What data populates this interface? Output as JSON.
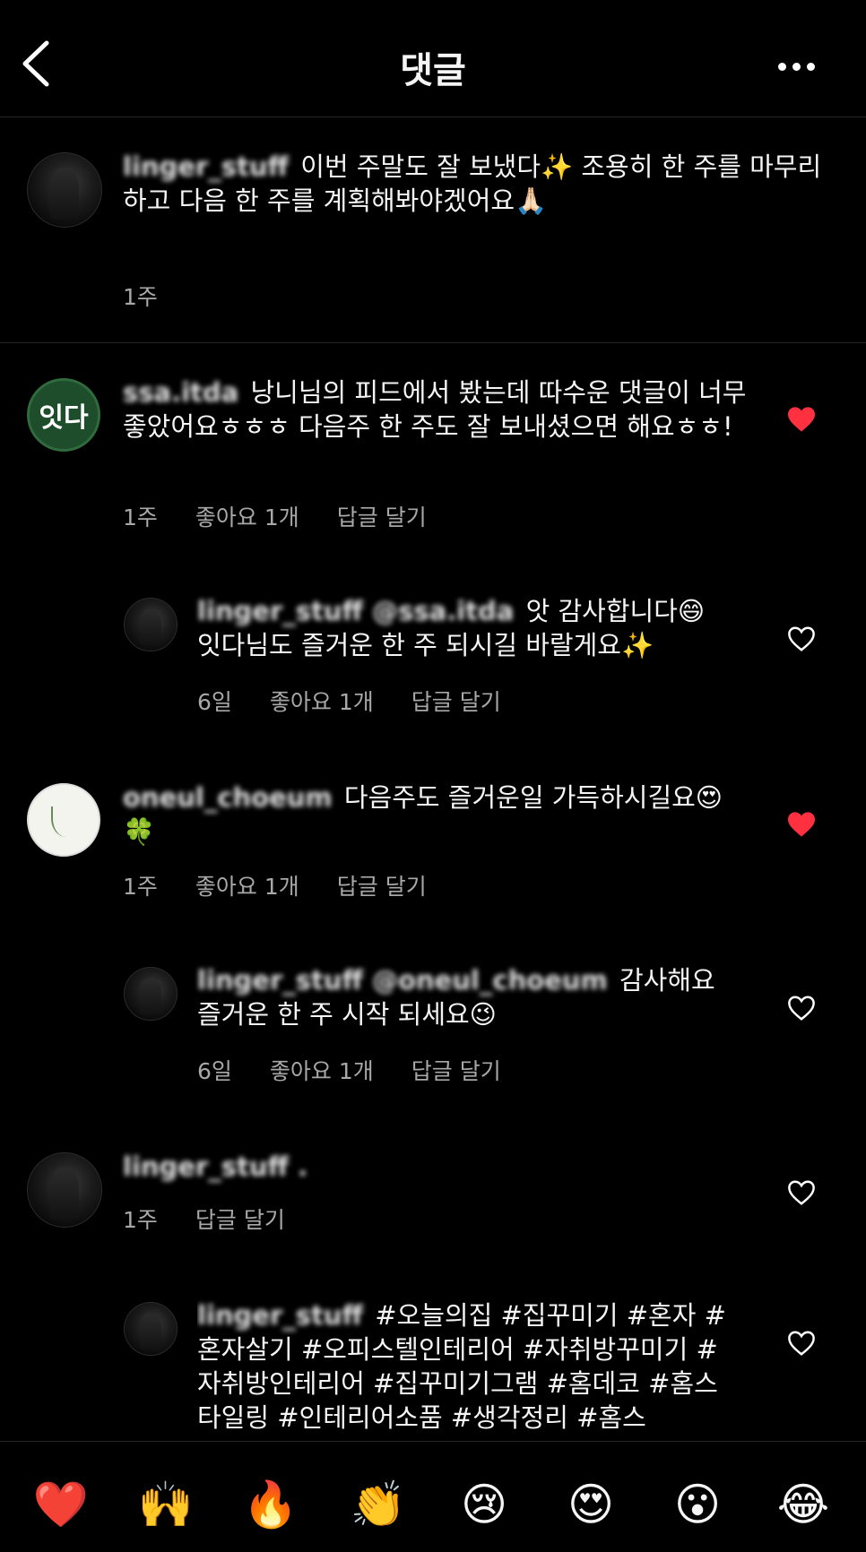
{
  "header": {
    "title": "댓글"
  },
  "caption": {
    "username": "linger_stuff",
    "text": "이번 주말도 잘 보냈다✨ 조용히 한 주를 마무리하고 다음 한 주를 계획해봐야겠어요🙏🏻",
    "time": "1주"
  },
  "comments": [
    {
      "username": "ssa.itda",
      "text": "낭니님의 피드에서 봤는데 따수운 댓글이 너무 좋았어요ㅎㅎㅎ 다음주 한 주도 잘 보내셨으면 해요ㅎㅎ!",
      "time": "1주",
      "likes": "좋아요 1개",
      "reply": "답글 달기"
    },
    {
      "username": "linger_stuff @ssa.itda",
      "text": "앗 감사합니다😄 잇다님도 즐거운 한 주 되시길 바랄게요✨",
      "time": "6일",
      "likes": "좋아요 1개",
      "reply": "답글 달기"
    },
    {
      "username": "oneul_choeum",
      "text": "다음주도 즐거운일 가득하시길요😍🍀",
      "time": "1주",
      "likes": "좋아요 1개",
      "reply": "답글 달기"
    },
    {
      "username": "linger_stuff @oneul_choeum",
      "text": "감사해요 즐거운 한 주 시작 되세요😉",
      "time": "6일",
      "likes": "좋아요 1개",
      "reply": "답글 달기"
    },
    {
      "username": "linger_stuff .",
      "text": "",
      "time": "1주",
      "reply": "답글 달기"
    },
    {
      "username": "linger_stuff",
      "text": "#오늘의집 #집꾸미기 #혼자 #혼자살기 #오피스텔인테리어 #자취방꾸미기 #자취방인테리어 #집꾸미기그램 #홈데코 #홈스타일링 #인테리어소품 #생각정리 #홈스"
    }
  ],
  "itda_avatar_text": "잇다",
  "reactions": [
    "❤️",
    "🙌",
    "🔥",
    "👏",
    "😢",
    "😍",
    "😮",
    "😂"
  ],
  "colors": {
    "liked": "#ff3040",
    "muted": "#a8a8a8"
  }
}
